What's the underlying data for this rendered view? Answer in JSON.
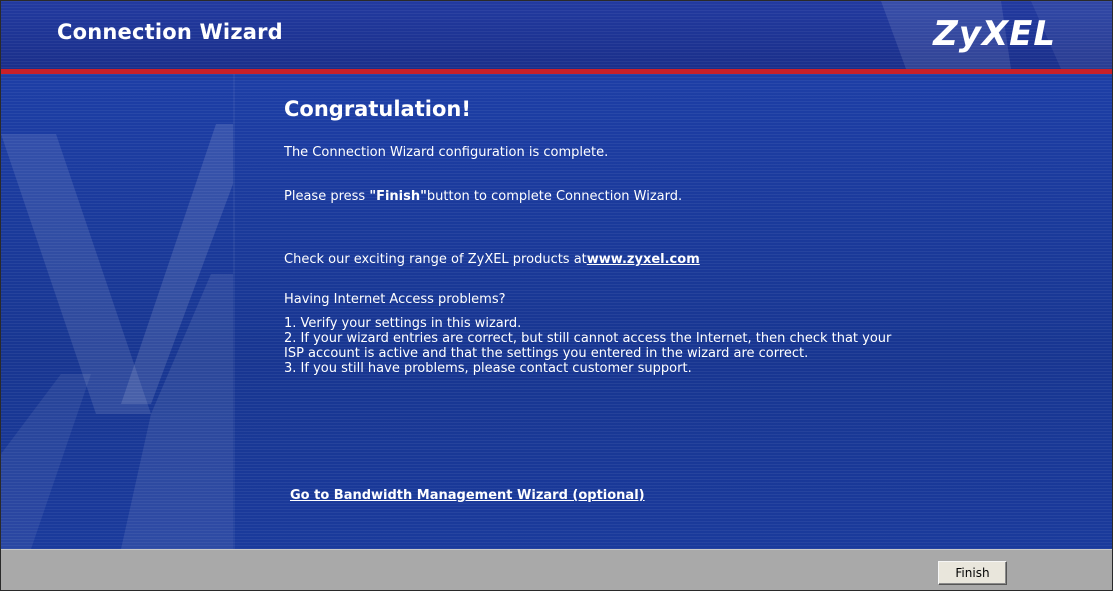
{
  "header": {
    "title": "Connection Wizard",
    "brand": "ZyXEL"
  },
  "main": {
    "heading": "Congratulation!",
    "line1": "The Connection Wizard configuration is complete.",
    "line2_prefix": "Please press ",
    "line2_bold": "\"Finish\"",
    "line2_suffix": "button to complete Connection Wizard.",
    "products_prefix": "Check our exciting range of ZyXEL products at",
    "products_link": "www.zyxel.com",
    "problems_question": "Having Internet Access problems?",
    "steps": [
      "1. Verify your settings in this wizard.",
      "2. If your wizard entries are correct, but still cannot access the Internet, then check that your",
      "ISP account is active and that the settings you entered in the wizard are correct.",
      "3. If you still have problems, please contact customer support."
    ],
    "bandwidth_link": "Go to Bandwidth Management Wizard (optional)"
  },
  "footer": {
    "finish_label": "Finish"
  },
  "colors": {
    "header_bg": "#1d3391",
    "accent_rule": "#c8202a",
    "main_bg": "#1a3797",
    "footer_bg": "#a9a9a9",
    "text": "#ffffff"
  }
}
